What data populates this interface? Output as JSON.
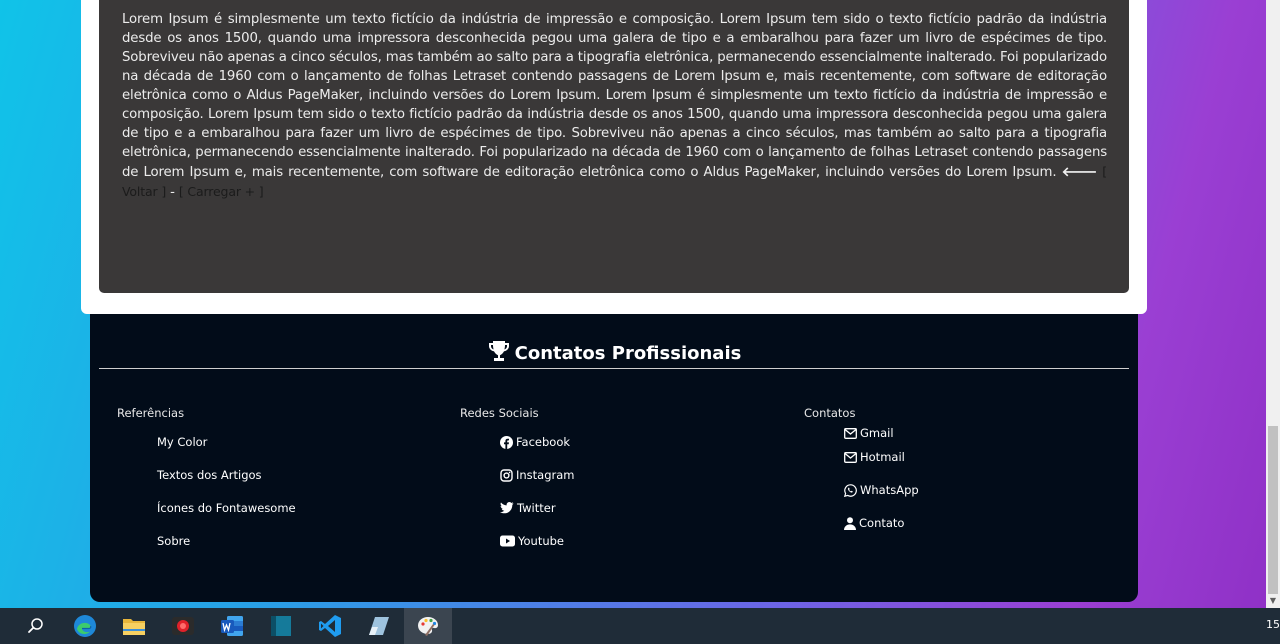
{
  "article": {
    "body": "Lorem Ipsum é simplesmente um texto fictício da indústria de impressão e composição. Lorem Ipsum tem sido o texto fictício padrão da indústria desde os anos 1500, quando uma impressora desconhecida pegou uma galera de tipo e a embaralhou para fazer um livro de espécimes de tipo. Sobreviveu não apenas a cinco séculos, mas também ao salto para a tipografia eletrônica, permanecendo essencialmente inalterado. Foi popularizado na década de 1960 com o lançamento de folhas Letraset contendo passagens de Lorem Ipsum e, mais recentemente, com software de editoração eletrônica como o Aldus PageMaker, incluindo versões do Lorem Ipsum. Lorem Ipsum é simplesmente um texto fictício da indústria de impressão e composição. Lorem Ipsum tem sido o texto fictício padrão da indústria desde os anos 1500, quando uma impressora desconhecida pegou uma galera de tipo e a embaralhou para fazer um livro de espécimes de tipo. Sobreviveu não apenas a cinco séculos, mas também ao salto para a tipografia eletrônica, permanecendo essencialmente inalterado. Foi popularizado na década de 1960 com o lançamento de folhas Letraset contendo passagens de Lorem Ipsum e, mais recentemente, com software de editoração eletrônica como o Aldus PageMaker, incluindo versões do Lorem Ipsum.",
    "back_arrow": "🡐",
    "back_link": "[ Voltar ]",
    "separator": "-",
    "load_more_link": "[ Carregar + ]"
  },
  "footer": {
    "title": "Contatos Profissionais",
    "icon": "trophy-icon",
    "columns": {
      "references": {
        "heading": "Referências",
        "items": [
          "My Color",
          "Textos dos Artigos",
          "Ícones do Fontawesome",
          "Sobre"
        ]
      },
      "social": {
        "heading": "Redes Sociais",
        "items": [
          {
            "label": "Facebook",
            "icon": "facebook-icon"
          },
          {
            "label": "Instagram",
            "icon": "instagram-icon"
          },
          {
            "label": "Twitter",
            "icon": "twitter-icon"
          },
          {
            "label": "Youtube",
            "icon": "youtube-icon"
          }
        ]
      },
      "contacts": {
        "heading": "Contatos",
        "items": [
          {
            "label": "Gmail",
            "icon": "envelope-icon"
          },
          {
            "label": "Hotmail",
            "icon": "envelope-icon"
          },
          {
            "label": "WhatsApp",
            "icon": "whatsapp-icon"
          },
          {
            "label": "Contato",
            "icon": "user-icon"
          }
        ]
      }
    }
  },
  "taskbar": {
    "apps": [
      "search-icon",
      "edge-icon",
      "file-explorer-icon",
      "screen-recorder-icon",
      "word-icon",
      "sidebar-app-icon",
      "vscode-icon",
      "eraser-app-icon",
      "paint-icon"
    ],
    "clock": "15"
  },
  "colors": {
    "article_bg": "#3a3838",
    "footer_bg": "#020c19",
    "taskbar_bg": "#1f2c38"
  }
}
